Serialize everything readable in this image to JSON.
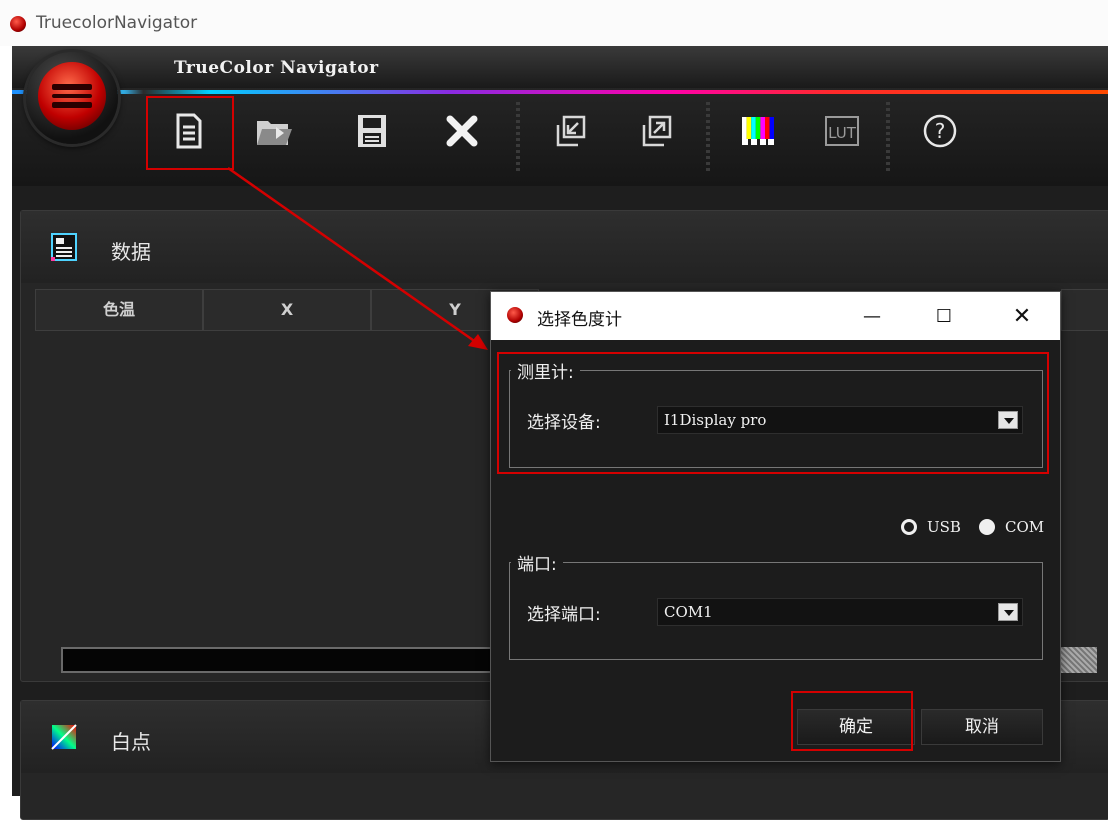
{
  "os": {
    "title": "TruecolorNavigator"
  },
  "app": {
    "title": "TrueColor Navigator",
    "toolbar": {
      "items": [
        {
          "icon": "new-document-icon"
        },
        {
          "icon": "open-folder-icon"
        },
        {
          "icon": "save-icon"
        },
        {
          "icon": "delete-icon"
        },
        {
          "icon": "import-icon"
        },
        {
          "icon": "export-icon"
        },
        {
          "icon": "test-pattern-icon"
        },
        {
          "icon": "lut-icon"
        },
        {
          "icon": "help-icon"
        }
      ],
      "lut_label": "LUT",
      "help_label": "?"
    },
    "data_panel": {
      "title": "数据",
      "columns": [
        "色温",
        "X",
        "Y"
      ]
    },
    "whitepoint_panel": {
      "title": "白点"
    }
  },
  "dialog": {
    "title": "选择色度计",
    "controls": {
      "minimize": "—",
      "maximize": "☐",
      "close": "✕"
    },
    "meter": {
      "legend": "测里计:",
      "device_label": "选择设备:",
      "device_value": "I1Display pro"
    },
    "connection": {
      "options": [
        "USB",
        "COM"
      ],
      "selected": "COM"
    },
    "port": {
      "legend": "端口:",
      "port_label": "选择端口:",
      "port_value": "COM1"
    },
    "ok_label": "确定",
    "cancel_label": "取消"
  },
  "colors": {
    "app_bg": "#1e1e1e",
    "highlight": "#d40000",
    "accent_red": "#c00000"
  }
}
